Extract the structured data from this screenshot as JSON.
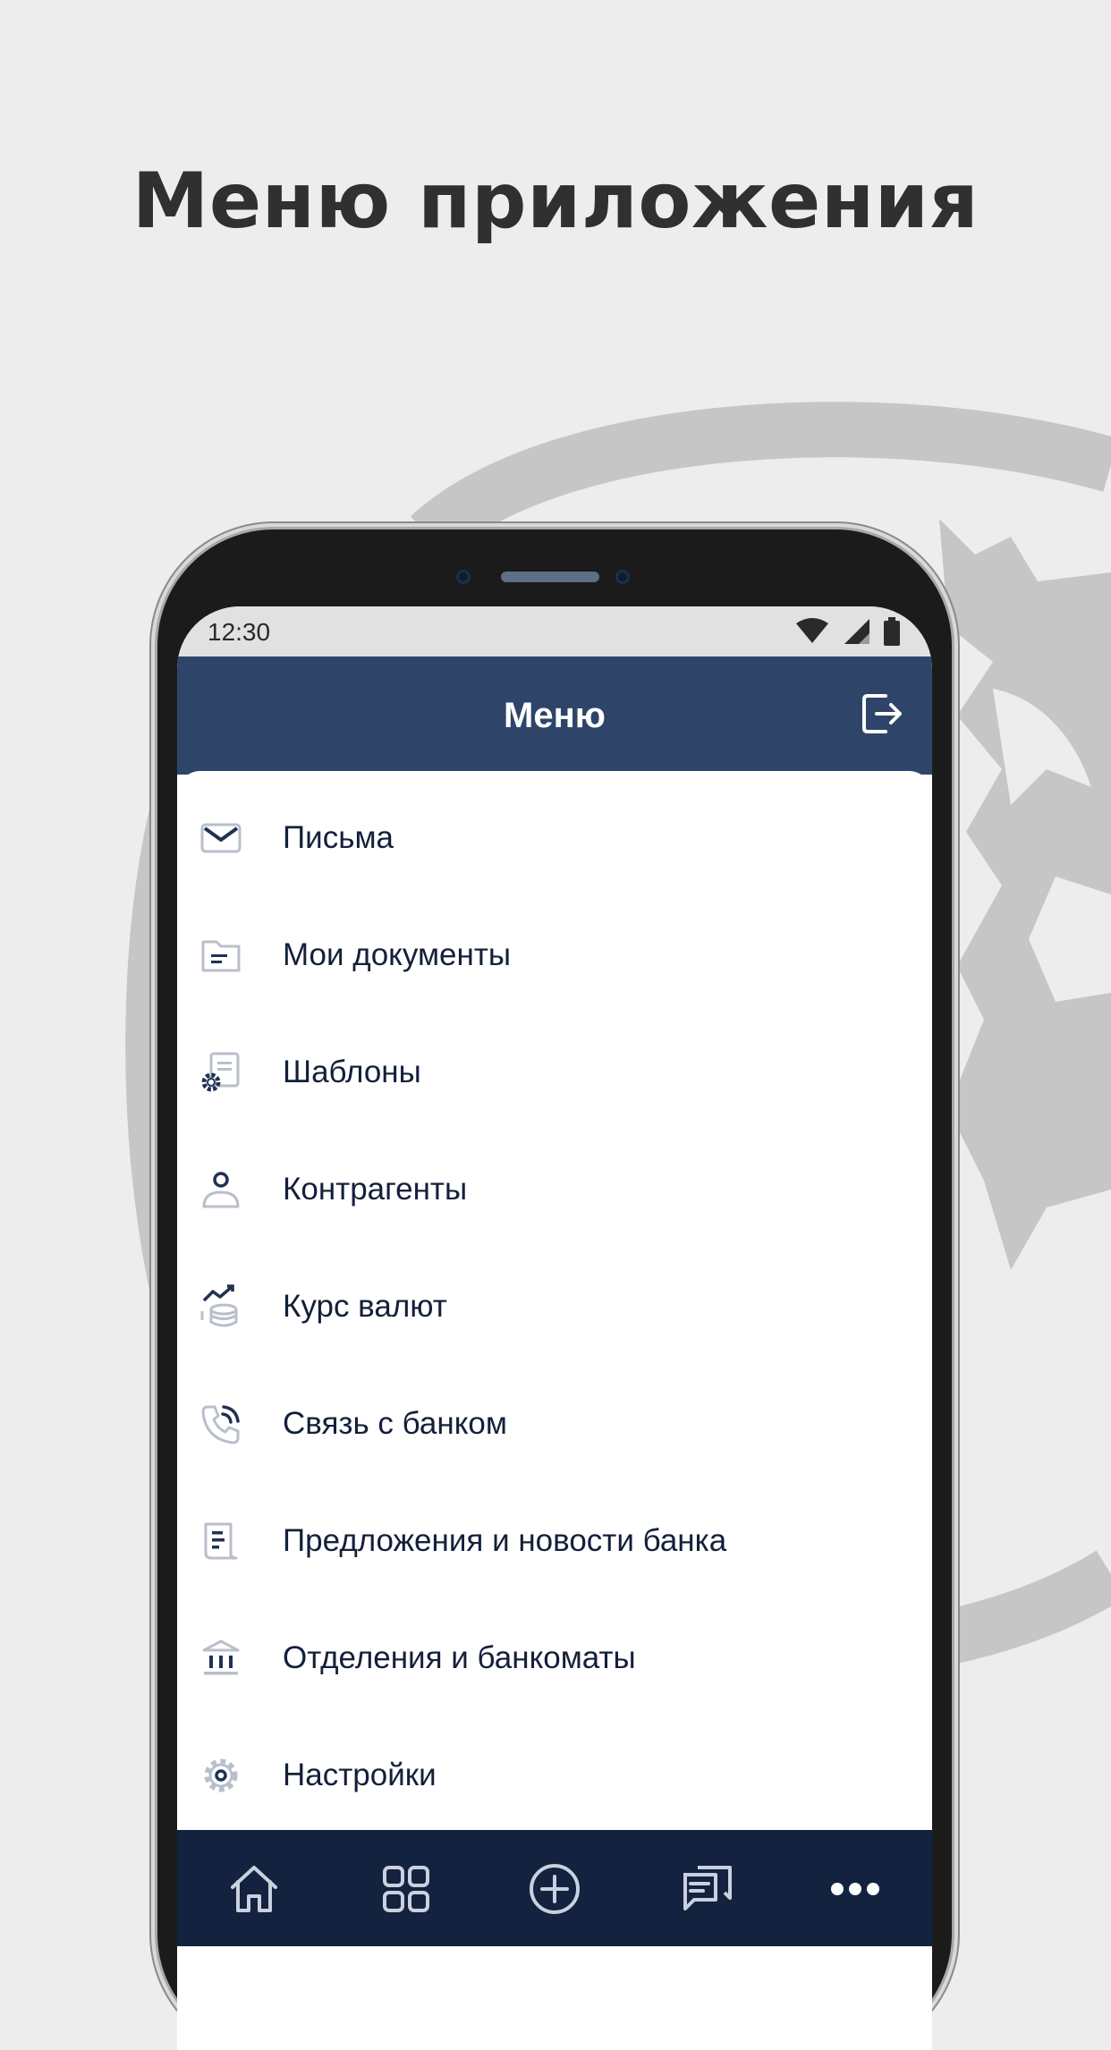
{
  "headline": "Меню приложения",
  "status": {
    "time": "12:30"
  },
  "appbar": {
    "title": "Меню",
    "logout_icon": "logout-icon"
  },
  "menu": [
    {
      "label": "Письма",
      "icon": "mail-icon"
    },
    {
      "label": "Мои документы",
      "icon": "folder-icon"
    },
    {
      "label": "Шаблоны",
      "icon": "template-gear-icon"
    },
    {
      "label": "Контрагенты",
      "icon": "person-icon"
    },
    {
      "label": "Курс валют",
      "icon": "currency-rate-icon"
    },
    {
      "label": "Связь с банком",
      "icon": "phone-call-icon"
    },
    {
      "label": "Предложения и новости банка",
      "icon": "news-icon"
    },
    {
      "label": "Отделения и банкоматы",
      "icon": "bank-building-icon"
    },
    {
      "label": "Настройки",
      "icon": "gear-icon"
    }
  ],
  "bottom_nav": [
    {
      "icon": "home-icon"
    },
    {
      "icon": "grid-icon"
    },
    {
      "icon": "plus-circle-icon"
    },
    {
      "icon": "chat-icon"
    },
    {
      "icon": "more-dots-icon"
    }
  ],
  "colors": {
    "appbar": "#2e4569",
    "bottom_nav": "#13223f",
    "text": "#14203a",
    "icon_accent": "#1f3254",
    "icon_light": "#b9bfca"
  }
}
